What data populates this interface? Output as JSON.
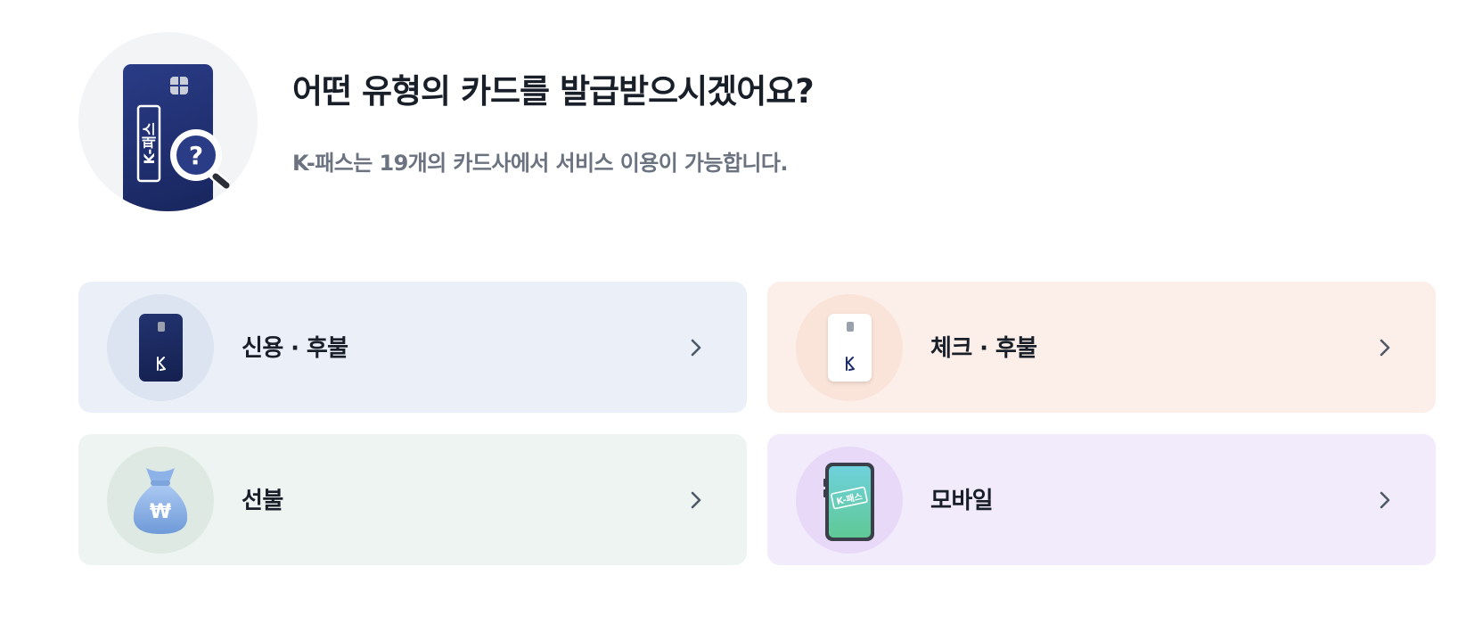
{
  "header": {
    "title": "어떤 유형의 카드를 발급받으시겠어요?",
    "subtitle": "K-패스는 19개의 카드사에서 서비스 이용이 가능합니다.",
    "illustration": {
      "card_logo_text": "K-패스",
      "magnifier_symbol": "?"
    }
  },
  "options": [
    {
      "label": "신용 · 후불",
      "icon": "dark-card-icon",
      "color": "#ebf0f8"
    },
    {
      "label": "체크 · 후불",
      "icon": "white-card-icon",
      "color": "#fcefea"
    },
    {
      "label": "선불",
      "icon": "money-bag-icon",
      "color": "#eef4f1"
    },
    {
      "label": "모바일",
      "icon": "smartphone-icon",
      "color": "#f2ebfb"
    }
  ],
  "mobile_screen_text": "K-패스",
  "money_symbol": "₩"
}
